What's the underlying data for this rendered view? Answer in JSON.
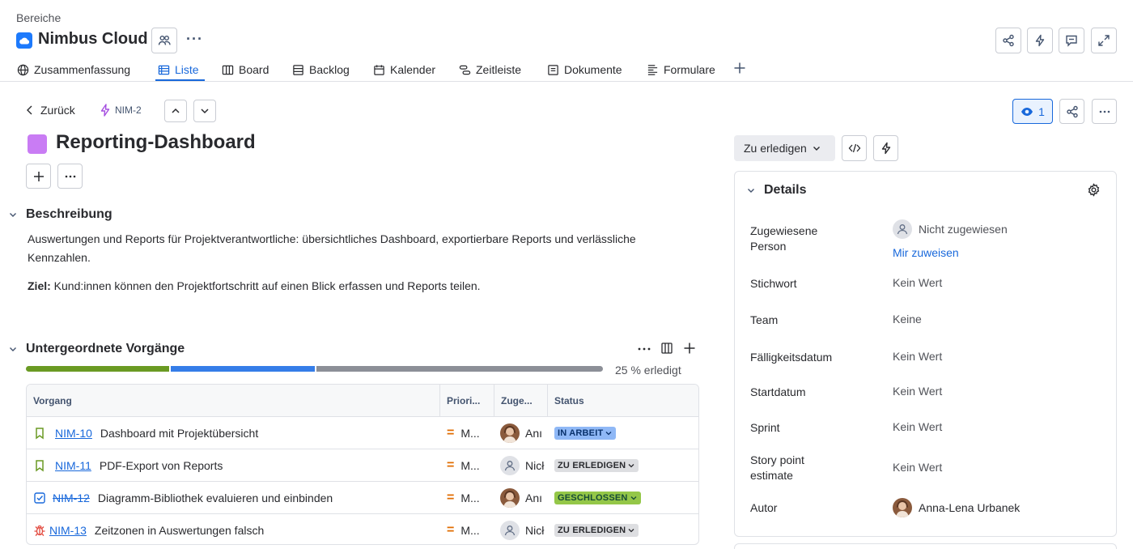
{
  "breadcrumb": "Bereiche",
  "project": {
    "name": "Nimbus Cloud",
    "more_label": "···"
  },
  "tabs": [
    {
      "label": "Zusammenfassung"
    },
    {
      "label": "Liste"
    },
    {
      "label": "Board"
    },
    {
      "label": "Backlog"
    },
    {
      "label": "Kalender"
    },
    {
      "label": "Zeitleiste"
    },
    {
      "label": "Dokumente"
    },
    {
      "label": "Formulare"
    }
  ],
  "issue_nav": {
    "back_label": "Zurück",
    "issue_key": "NIM-2"
  },
  "watch": {
    "count": "1"
  },
  "issue": {
    "title": "Reporting-Dashboard",
    "color": "#c97cf4"
  },
  "description": {
    "heading": "Beschreibung",
    "text": "Auswertungen und Reports für Projektverantwortliche: übersichtliches Dashboard, exportierbare Reports und verlässliche Kennzahlen.",
    "goal_label": "Ziel:",
    "goal_text": " Kund:innen können den Projektfortschritt auf einen Blick erfassen und Reports teilen."
  },
  "children": {
    "heading": "Untergeordnete Vorgänge",
    "progress_label": "25 % erledigt",
    "progress": {
      "done": 0.25,
      "in_progress": 0.25,
      "todo": 0.5
    },
    "columns": [
      "Vorgang",
      "Priori...",
      "Zuge...",
      "Status"
    ],
    "rows": [
      {
        "type": "story",
        "key": "NIM-10",
        "summary": "Dashboard mit Projektübersicht",
        "priority": "M...",
        "assignee": "Anı",
        "status": "IN ARBEIT",
        "status_kind": "blue",
        "done": false
      },
      {
        "type": "story",
        "key": "NIM-11",
        "summary": "PDF-Export von Reports",
        "priority": "M...",
        "assignee": "Nicł",
        "status": "ZU ERLEDIGEN",
        "status_kind": "gray",
        "done": false
      },
      {
        "type": "task",
        "key": "NIM-12",
        "summary": "Diagramm-Bibliothek evaluieren und einbinden",
        "priority": "M...",
        "assignee": "Anı",
        "status": "GESCHLOSSEN",
        "status_kind": "green",
        "done": true
      },
      {
        "type": "bug",
        "key": "NIM-13",
        "summary": "Zeitzonen in Auswertungen falsch",
        "priority": "M...",
        "assignee": "Nicł",
        "status": "ZU ERLEDIGEN",
        "status_kind": "gray",
        "done": false
      }
    ]
  },
  "status_button": {
    "label": "Zu erledigen"
  },
  "details": {
    "heading": "Details",
    "fields": [
      {
        "label": "Zugewiesene Person",
        "value": "Nicht zugewiesen",
        "action": "Mir zuweisen"
      },
      {
        "label": "Stichwort",
        "value": "Kein Wert"
      },
      {
        "label": "Team",
        "value": "Keine"
      },
      {
        "label": "Fälligkeitsdatum",
        "value": "Kein Wert"
      },
      {
        "label": "Startdatum",
        "value": "Kein Wert"
      },
      {
        "label": "Sprint",
        "value": "Kein Wert"
      },
      {
        "label": "Story point estimate",
        "value": "Kein Wert"
      },
      {
        "label": "Autor",
        "value": "Anna-Lena Urbanek"
      }
    ]
  },
  "colors": {
    "accent": "#1868db",
    "done": "#6a9a23",
    "in_progress": "#357de8",
    "todo": "#8c8f97"
  }
}
